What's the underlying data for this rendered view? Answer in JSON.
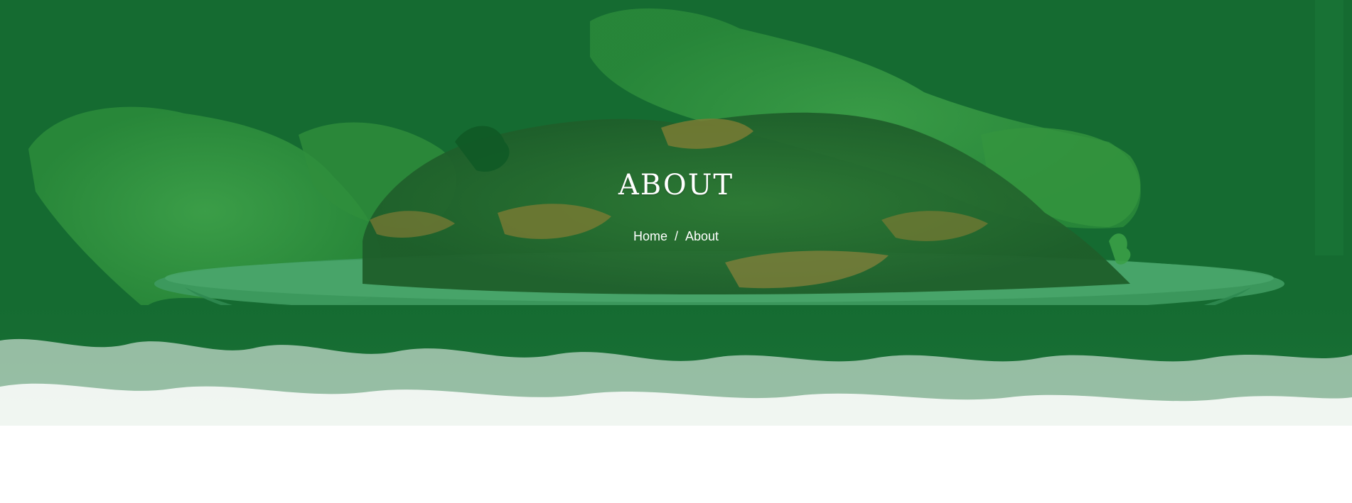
{
  "hero": {
    "title": "ABOUT",
    "overlay_color": "#156b31",
    "breadcrumb": {
      "home": "Home",
      "separator": "/",
      "current": "About"
    }
  }
}
